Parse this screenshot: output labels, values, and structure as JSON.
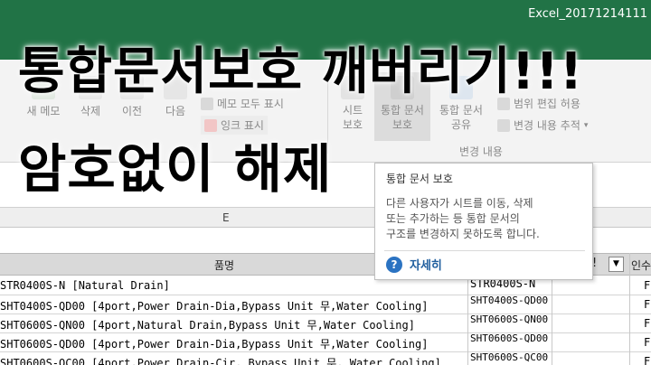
{
  "window": {
    "title": "Excel_20171214111"
  },
  "ribbon": {
    "buttons": [
      {
        "label": "새 메모"
      },
      {
        "label": "삭제"
      },
      {
        "label": "이전"
      },
      {
        "label": "다음"
      }
    ],
    "memo_show_all": "메모 모두 표시",
    "ink_show": "잉크 표시",
    "protect_sheet_line1": "시트",
    "protect_sheet_line2": "보호",
    "protect_workbook_line1": "통합 문서",
    "protect_workbook_line2": "보호",
    "share_workbook_line1": "통합 문서",
    "share_workbook_line2": "공유",
    "allow_edit_ranges": "범위 편집 허용",
    "track_changes": "변경 내용 추적",
    "changes_group": "변경 내용"
  },
  "headline": {
    "line1": "통합문서보호 깨버리기!!!",
    "line2": "암호없이 해제"
  },
  "tooltip": {
    "title": "통합 문서 보호",
    "body_line1": "다른 사용자가 시트를 이동, 삭제",
    "body_line2": "또는 추가하는 등 통합 문서의",
    "body_line3": "구조를 변경하지 못하도록 합니다.",
    "help": "자세히"
  },
  "sheet": {
    "column_letter": "E",
    "header": {
      "name": "품명",
      "bang": "!",
      "last": "인수"
    },
    "rows": [
      {
        "name": "STR0400S-N [Natural Drain]",
        "code": "STR0400S-N",
        "last": "F"
      },
      {
        "name": "SHT0400S-QD00 [4port,Power Drain-Dia,Bypass Unit 무,Water Cooling]",
        "code": "SHT0400S-QD00",
        "last": "F"
      },
      {
        "name": "SHT0600S-QN00 [4port,Natural Drain,Bypass Unit 무,Water Cooling]",
        "code": "SHT0600S-QN00",
        "last": "F"
      },
      {
        "name": "SHT0600S-QD00 [4port,Power Drain-Dia,Bypass Unit 무,Water Cooling]",
        "code": "SHT0600S-QD00",
        "last": "F"
      },
      {
        "name": "SHT0600S-QC00 [4port,Power Drain-Cir, Bypass Unit 무, Water Cooling]",
        "code": "SHT0600S-QC00",
        "last": "F"
      }
    ]
  }
}
